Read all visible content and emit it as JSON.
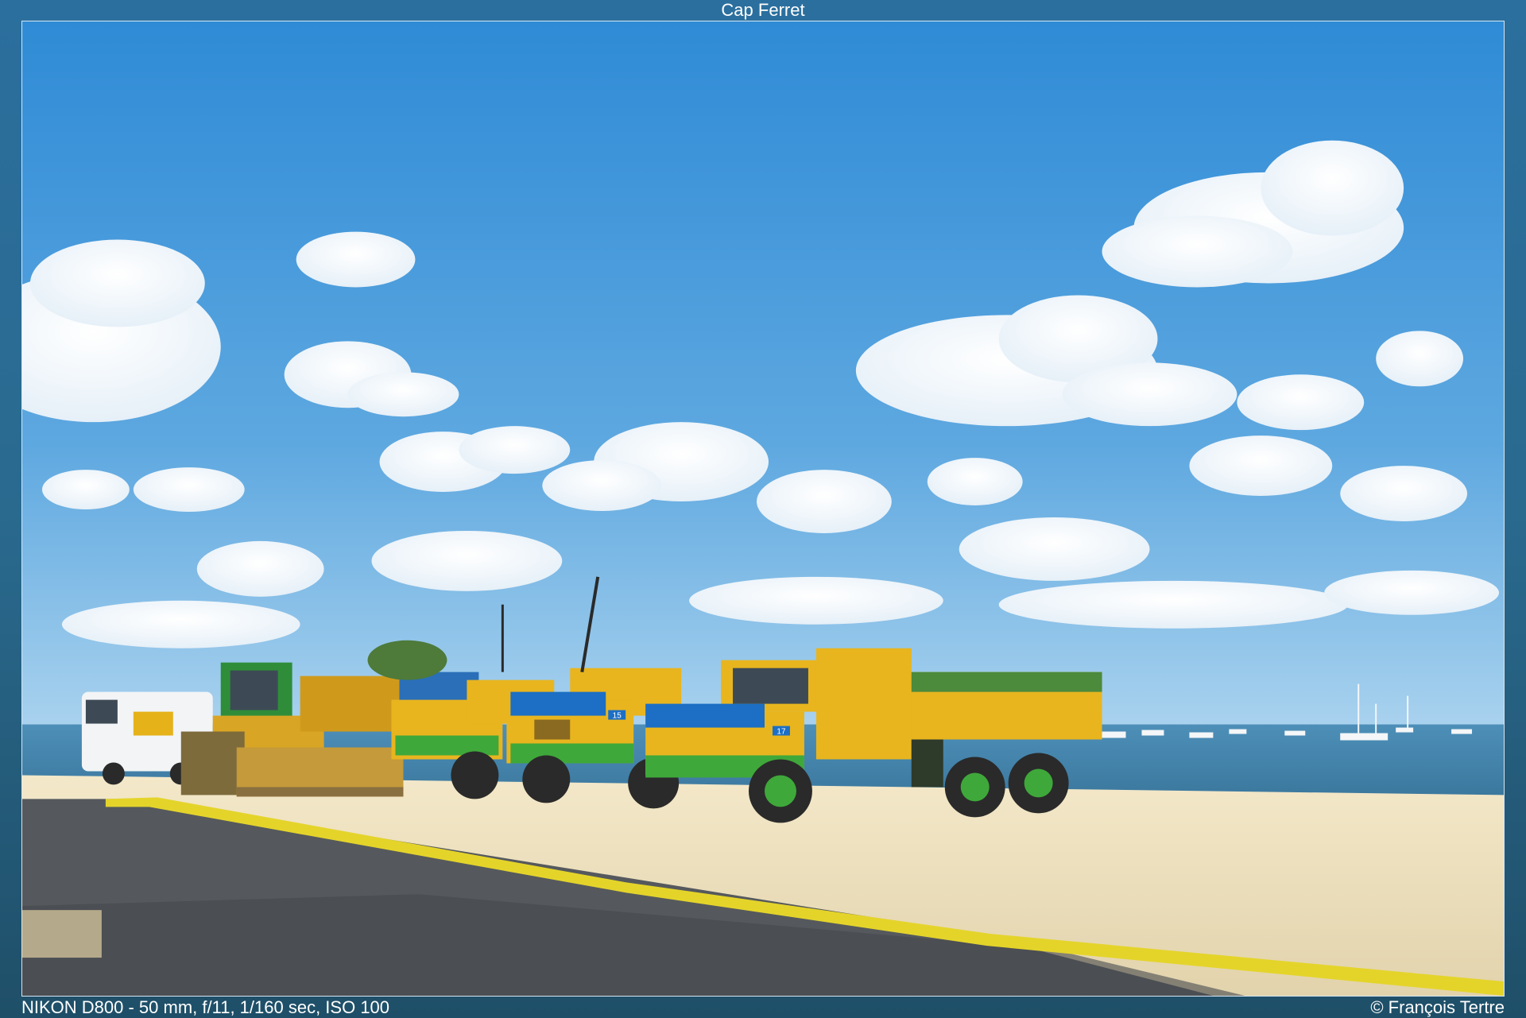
{
  "header": {
    "title": "Cap Ferret"
  },
  "footer": {
    "exif": "NIKON D800 - 50 mm, f/11, 1/160 sec, ISO 100",
    "copyright": "© François Tertre"
  },
  "truck_numbers": [
    "15",
    "17"
  ],
  "colors": {
    "sky_top": "#2f8bd6",
    "sky_bottom": "#8ec4ea",
    "sea": "#3d7fa6",
    "sand": "#efe3c2",
    "road": "#5a5d60",
    "truck_yellow": "#e8b51f",
    "truck_blue": "#1c6fc4",
    "truck_green": "#3fa83a",
    "curb_yellow": "#e4d42a"
  }
}
